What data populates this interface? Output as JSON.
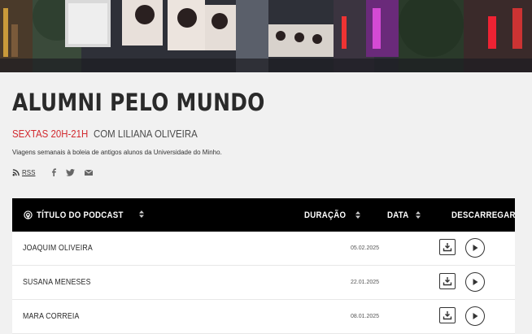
{
  "program": {
    "title": "ALUMNI PELO MUNDO",
    "time": "SEXTAS 20H-21H",
    "host": "COM LILIANA OLIVEIRA",
    "description": "Viagens semanais à boleia de antigos alunos da Universidade do Minho."
  },
  "social": {
    "rss_label": "RSS",
    "icons": [
      "rss-icon",
      "facebook-icon",
      "twitter-icon",
      "email-icon"
    ]
  },
  "table": {
    "headers": {
      "title": "TÍTULO DO PODCAST",
      "duration": "DURAÇÃO",
      "date": "DATA",
      "download": "DESCARREGAR"
    },
    "rows": [
      {
        "name": "JOAQUIM OLIVEIRA",
        "date": "05.02.2025"
      },
      {
        "name": "SUSANA MENESES",
        "date": "22.01.2025"
      },
      {
        "name": "MARA CORREIA",
        "date": "08.01.2025"
      }
    ]
  },
  "colors": {
    "accent": "#d22a2f",
    "header_bg": "#000000",
    "page_bg": "#f1f1f1"
  }
}
